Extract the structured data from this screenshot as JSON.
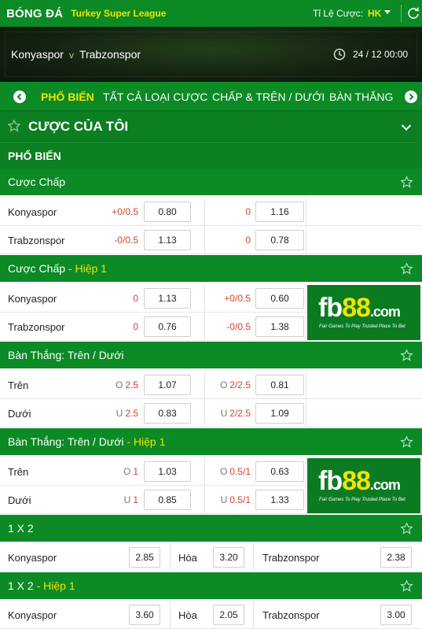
{
  "header": {
    "brand": "BÓNG ĐÁ",
    "league": "Turkey Super League",
    "odds_label": "Tỉ Lệ Cược:",
    "odds_value": "HK"
  },
  "match": {
    "home": "Konyaspor",
    "vs": "v",
    "away": "Trabzonspor",
    "datetime": "24 / 12  00:00"
  },
  "tabs": [
    {
      "label": "PHỔ BIẾN",
      "active": true
    },
    {
      "label": "TẤT CẢ LOẠI CƯỢC"
    },
    {
      "label": "CHẤP & TRÊN / DƯỚI"
    },
    {
      "label": "BÀN THẮNG"
    }
  ],
  "my_bets": {
    "title": "CƯỢC CỦA TÔI"
  },
  "popular": {
    "title": "PHỔ BIẾN"
  },
  "sections": {
    "handicap": {
      "title": "Cược Chấp",
      "rows": [
        {
          "team": "Konyaspor",
          "hc1": "+0/0.5",
          "odd1": "0.80",
          "hc2": "0",
          "odd2": "1.16"
        },
        {
          "team": "Trabzonspor",
          "hc1": "-0/0.5",
          "odd1": "1.13",
          "hc2": "0",
          "odd2": "0.78"
        }
      ]
    },
    "handicap_h1": {
      "title": "Cược Chấp",
      "suffix": " - Hiệp 1",
      "rows": [
        {
          "team": "Konyaspor",
          "hc1": "0",
          "odd1": "1.13",
          "hc2": "+0/0.5",
          "odd2": "0.60"
        },
        {
          "team": "Trabzonspor",
          "hc1": "0",
          "odd1": "0.76",
          "hc2": "-0/0.5",
          "odd2": "1.38"
        }
      ]
    },
    "ou": {
      "title": "Bàn Thắng: Trên / Dưới",
      "rows": [
        {
          "team": "Trên",
          "p1": "O",
          "hc1": "2.5",
          "odd1": "1.07",
          "p2": "O",
          "hc2": "2/2.5",
          "odd2": "0.81"
        },
        {
          "team": "Dưới",
          "p1": "U",
          "hc1": "2.5",
          "odd1": "0.83",
          "p2": "U",
          "hc2": "2/2.5",
          "odd2": "1.09"
        }
      ]
    },
    "ou_h1": {
      "title": "Bàn Thắng: Trên / Dưới",
      "suffix": " - Hiệp 1",
      "rows": [
        {
          "team": "Trên",
          "p1": "O",
          "hc1": "1",
          "odd1": "1.03",
          "p2": "O",
          "hc2": "0.5/1",
          "odd2": "0.63"
        },
        {
          "team": "Dưới",
          "p1": "U",
          "hc1": "1",
          "odd1": "0.85",
          "p2": "U",
          "hc2": "0.5/1",
          "odd2": "1.33"
        }
      ]
    },
    "x12": {
      "title": "1 X 2",
      "row": {
        "home": "Konyaspor",
        "home_odd": "2.85",
        "draw": "Hòa",
        "draw_odd": "3.20",
        "away": "Trabzonspor",
        "away_odd": "2.38"
      }
    },
    "x12_h1": {
      "title": "1 X 2",
      "suffix": " - Hiệp 1",
      "row": {
        "home": "Konyaspor",
        "home_odd": "3.60",
        "draw": "Hòa",
        "draw_odd": "2.05",
        "away": "Trabzonspor",
        "away_odd": "3.00"
      }
    }
  },
  "banner": {
    "logo_fb": "fb",
    "logo_88": "88",
    "logo_com": ".com",
    "tagline": "Fair Games To Play   Trusted Place To Bet"
  },
  "colors": {
    "primary": "#0b8a25",
    "accent": "#f2e400",
    "handicap": "#d0452a"
  }
}
